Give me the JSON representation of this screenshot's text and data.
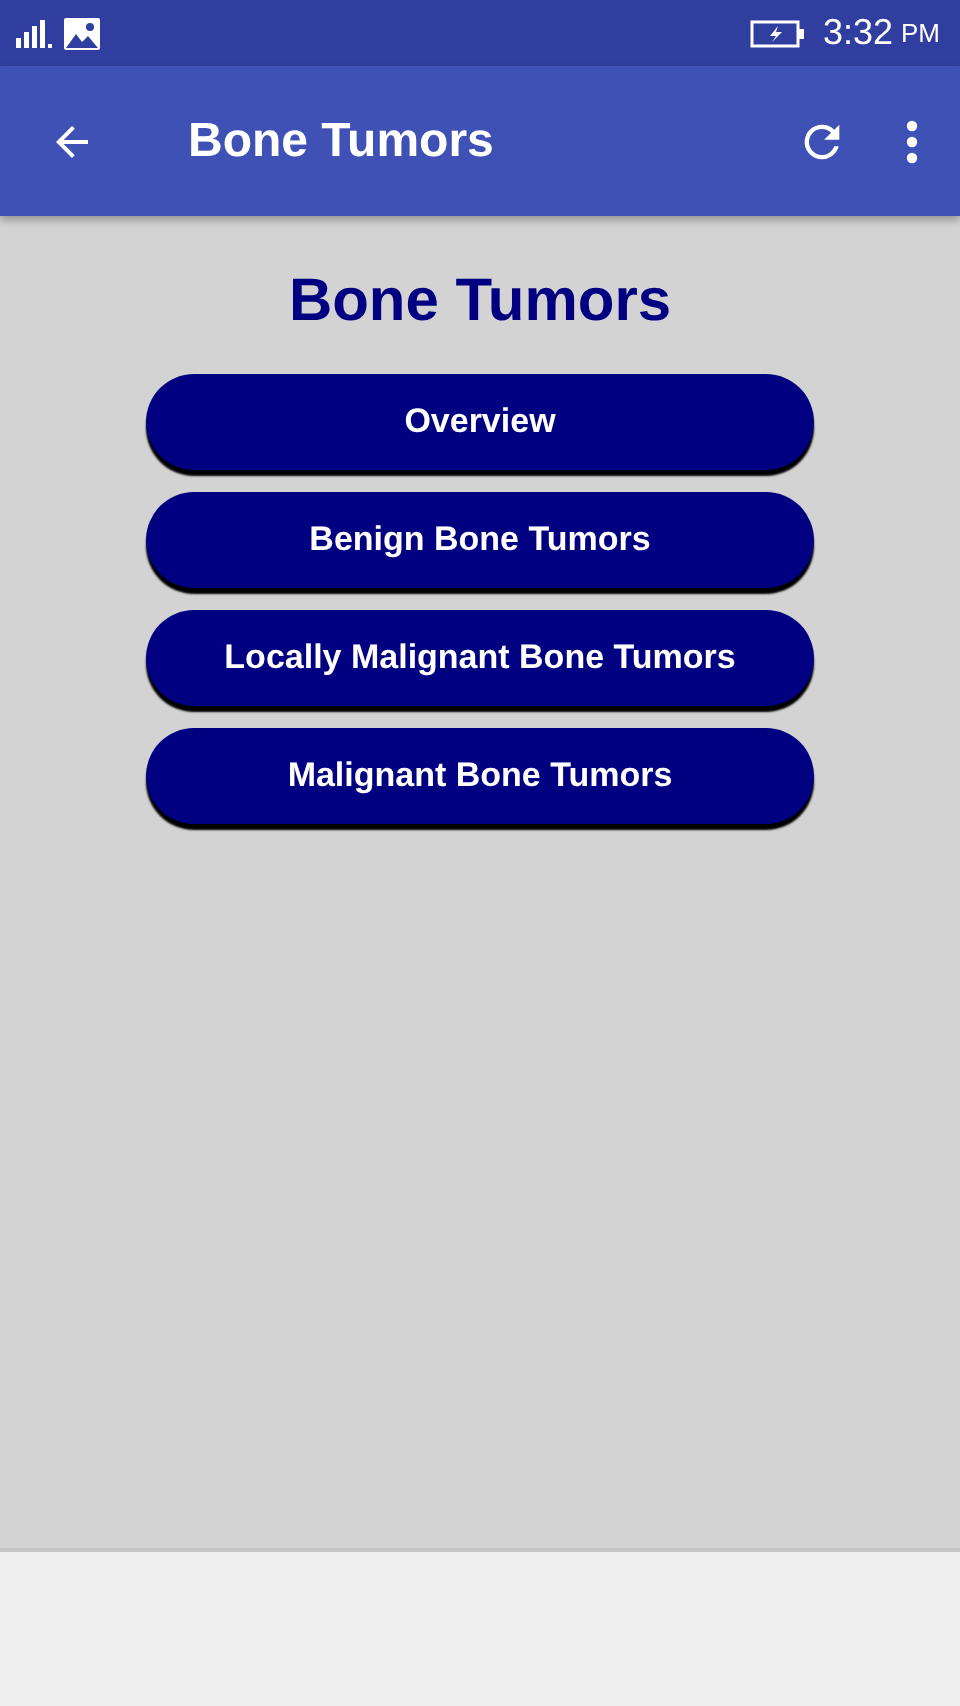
{
  "status_bar": {
    "time": "3:32",
    "period": "PM"
  },
  "toolbar": {
    "title": "Bone Tumors"
  },
  "heading": "Bone Tumors",
  "buttons": [
    "Overview",
    "Benign Bone Tumors",
    "Locally Malignant Bone Tumors",
    "Malignant Bone Tumors"
  ]
}
